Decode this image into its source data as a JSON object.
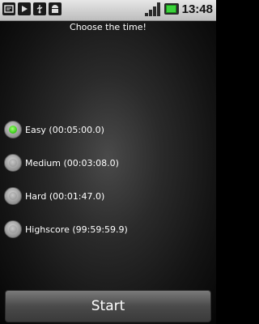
{
  "status_bar": {
    "time": "13:48",
    "icons": [
      "notification-icon",
      "play-icon",
      "usb-icon",
      "android-icon",
      "signal-icon",
      "battery-icon"
    ]
  },
  "header": {
    "title": "Choose the time!"
  },
  "options": [
    {
      "label": "Easy (00:05:00.0)",
      "checked": true
    },
    {
      "label": "Medium (00:03:08.0)",
      "checked": false
    },
    {
      "label": "Hard (00:01:47.0)",
      "checked": false
    },
    {
      "label": "Highscore (99:59:59.9)",
      "checked": false
    }
  ],
  "start_button": {
    "label": "Start"
  },
  "colors": {
    "selected": "#3fcf1d",
    "background": "#000000"
  }
}
